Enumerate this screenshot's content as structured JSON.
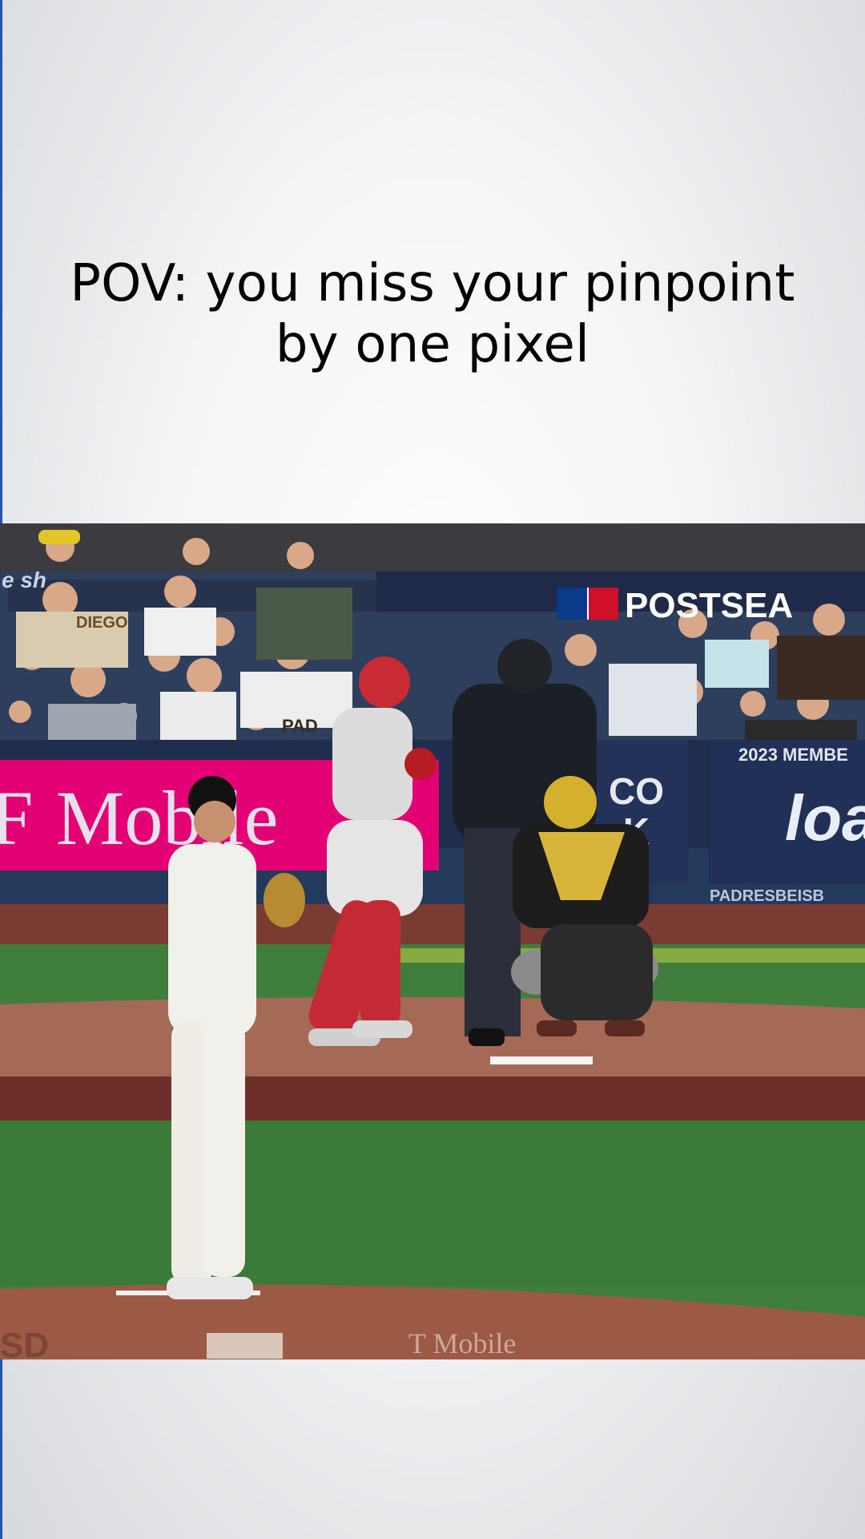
{
  "caption": {
    "text": "POV: you miss your pinpoint\nby one pixel"
  },
  "photo": {
    "board_left": "Mobile",
    "board_left_prefix": "F",
    "postseason": "POSTSEA",
    "member_board": "2023 MEMBE",
    "loa": "loa",
    "padres_board": "PADRESBEISB",
    "dirt_sponsor": "T Mobile",
    "crowd_top": "e sh",
    "fan_shirt": "DIEGO",
    "fan_shirt2": "SD",
    "co_text": "CO\nK",
    "jersey_pd": "PAD"
  },
  "colors": {
    "caption_text": "#000000",
    "tmobile_pink": "#e20074",
    "field_green": "#3f7f3b",
    "dirt": "#9c5a45",
    "board_navy": "#1f2d4f"
  }
}
